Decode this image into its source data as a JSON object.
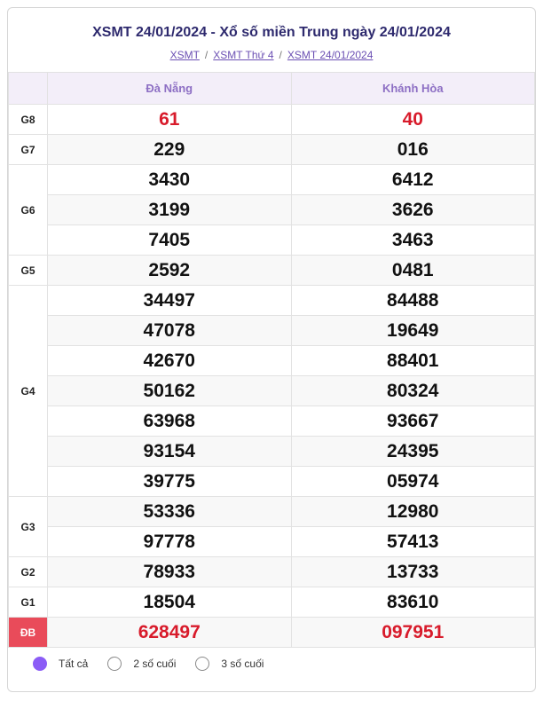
{
  "header": {
    "title": "XSMT 24/01/2024 - Xổ số miền Trung ngày 24/01/2024",
    "breadcrumb": [
      "XSMT",
      "XSMT Thứ 4",
      "XSMT 24/01/2024"
    ],
    "separator": "/"
  },
  "columns": [
    "Đà Nẵng",
    "Khánh Hòa"
  ],
  "prizes": [
    {
      "label": "G8",
      "danang": [
        "61"
      ],
      "khanhhoa": [
        "40"
      ],
      "highlight": true
    },
    {
      "label": "G7",
      "danang": [
        "229"
      ],
      "khanhhoa": [
        "016"
      ]
    },
    {
      "label": "G6",
      "danang": [
        "3430",
        "3199",
        "7405"
      ],
      "khanhhoa": [
        "6412",
        "3626",
        "3463"
      ]
    },
    {
      "label": "G5",
      "danang": [
        "2592"
      ],
      "khanhhoa": [
        "0481"
      ]
    },
    {
      "label": "G4",
      "danang": [
        "34497",
        "47078",
        "42670",
        "50162",
        "63968",
        "93154",
        "39775"
      ],
      "khanhhoa": [
        "84488",
        "19649",
        "88401",
        "80324",
        "93667",
        "24395",
        "05974"
      ]
    },
    {
      "label": "G3",
      "danang": [
        "53336",
        "97778"
      ],
      "khanhhoa": [
        "12980",
        "57413"
      ]
    },
    {
      "label": "G2",
      "danang": [
        "78933"
      ],
      "khanhhoa": [
        "13733"
      ]
    },
    {
      "label": "G1",
      "danang": [
        "18504"
      ],
      "khanhhoa": [
        "83610"
      ]
    },
    {
      "label": "ĐB",
      "danang": [
        "628497"
      ],
      "khanhhoa": [
        "097951"
      ],
      "highlight": true,
      "special": true
    }
  ],
  "filters": {
    "options": [
      "Tất cả",
      "2 số cuối",
      "3 số cuối"
    ],
    "selected": 0
  },
  "colors": {
    "accent": "#8b5cf6",
    "special": "#e94b5a",
    "highlight_number": "#d81b2b"
  }
}
